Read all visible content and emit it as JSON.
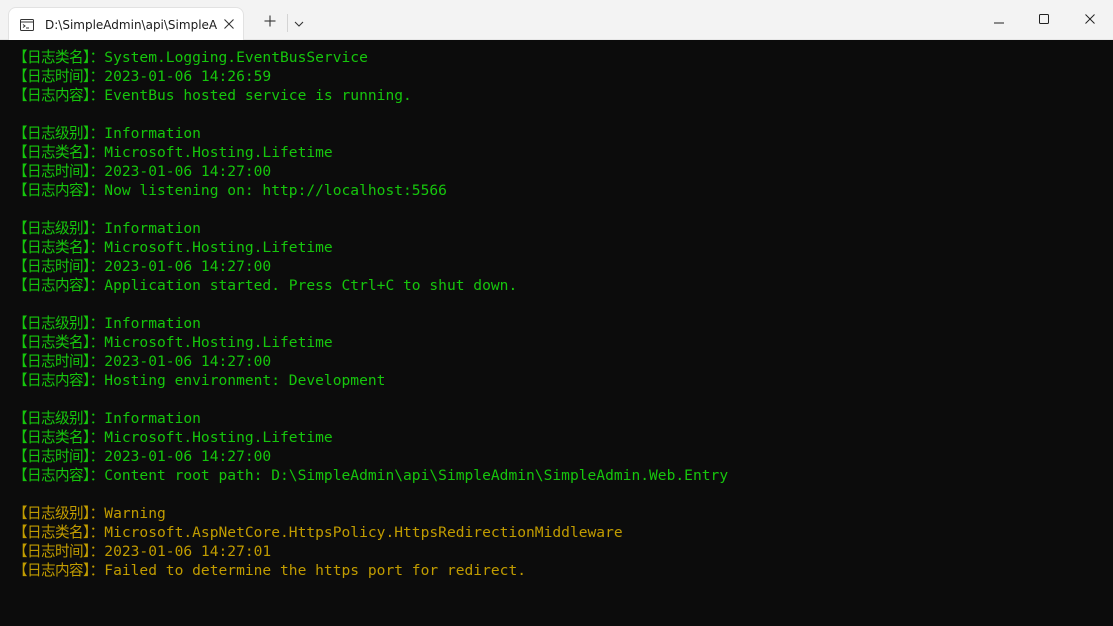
{
  "tab": {
    "title": "D:\\SimpleAdmin\\api\\SimpleA",
    "icon": "terminal-icon"
  },
  "titlebar": {
    "new_tab_icon": "plus-icon",
    "dropdown_icon": "chevron-down-icon",
    "minimize_icon": "minimize-icon",
    "maximize_icon": "maximize-icon",
    "close_icon": "close-icon"
  },
  "colors": {
    "info": "#16c60c",
    "warning": "#c19c00",
    "background": "#0c0c0c"
  },
  "terminal": {
    "lines": [
      {
        "label": "【日志类名】",
        "sep": "：",
        "value": "System.Logging.EventBusService",
        "level": "info"
      },
      {
        "label": "【日志时间】",
        "sep": "：",
        "value": "2023-01-06 14:26:59",
        "level": "info"
      },
      {
        "label": "【日志内容】",
        "sep": "：",
        "value": "EventBus hosted service is running.",
        "level": "info"
      },
      {
        "blank": true
      },
      {
        "label": "【日志级别】",
        "sep": "：",
        "value": "Information",
        "level": "info"
      },
      {
        "label": "【日志类名】",
        "sep": "：",
        "value": "Microsoft.Hosting.Lifetime",
        "level": "info"
      },
      {
        "label": "【日志时间】",
        "sep": "：",
        "value": "2023-01-06 14:27:00",
        "level": "info"
      },
      {
        "label": "【日志内容】",
        "sep": "：",
        "value": "Now listening on: http://localhost:5566",
        "level": "info"
      },
      {
        "blank": true
      },
      {
        "label": "【日志级别】",
        "sep": "：",
        "value": "Information",
        "level": "info"
      },
      {
        "label": "【日志类名】",
        "sep": "：",
        "value": "Microsoft.Hosting.Lifetime",
        "level": "info"
      },
      {
        "label": "【日志时间】",
        "sep": "：",
        "value": "2023-01-06 14:27:00",
        "level": "info"
      },
      {
        "label": "【日志内容】",
        "sep": "：",
        "value": "Application started. Press Ctrl+C to shut down.",
        "level": "info"
      },
      {
        "blank": true
      },
      {
        "label": "【日志级别】",
        "sep": "：",
        "value": "Information",
        "level": "info"
      },
      {
        "label": "【日志类名】",
        "sep": "：",
        "value": "Microsoft.Hosting.Lifetime",
        "level": "info"
      },
      {
        "label": "【日志时间】",
        "sep": "：",
        "value": "2023-01-06 14:27:00",
        "level": "info"
      },
      {
        "label": "【日志内容】",
        "sep": "：",
        "value": "Hosting environment: Development",
        "level": "info"
      },
      {
        "blank": true
      },
      {
        "label": "【日志级别】",
        "sep": "：",
        "value": "Information",
        "level": "info"
      },
      {
        "label": "【日志类名】",
        "sep": "：",
        "value": "Microsoft.Hosting.Lifetime",
        "level": "info"
      },
      {
        "label": "【日志时间】",
        "sep": "：",
        "value": "2023-01-06 14:27:00",
        "level": "info"
      },
      {
        "label": "【日志内容】",
        "sep": "：",
        "value": "Content root path: D:\\SimpleAdmin\\api\\SimpleAdmin\\SimpleAdmin.Web.Entry",
        "level": "info"
      },
      {
        "blank": true
      },
      {
        "label": "【日志级别】",
        "sep": "：",
        "value": "Warning",
        "level": "warning"
      },
      {
        "label": "【日志类名】",
        "sep": "：",
        "value": "Microsoft.AspNetCore.HttpsPolicy.HttpsRedirectionMiddleware",
        "level": "warning"
      },
      {
        "label": "【日志时间】",
        "sep": "：",
        "value": "2023-01-06 14:27:01",
        "level": "warning"
      },
      {
        "label": "【日志内容】",
        "sep": "：",
        "value": "Failed to determine the https port for redirect.",
        "level": "warning"
      }
    ]
  }
}
